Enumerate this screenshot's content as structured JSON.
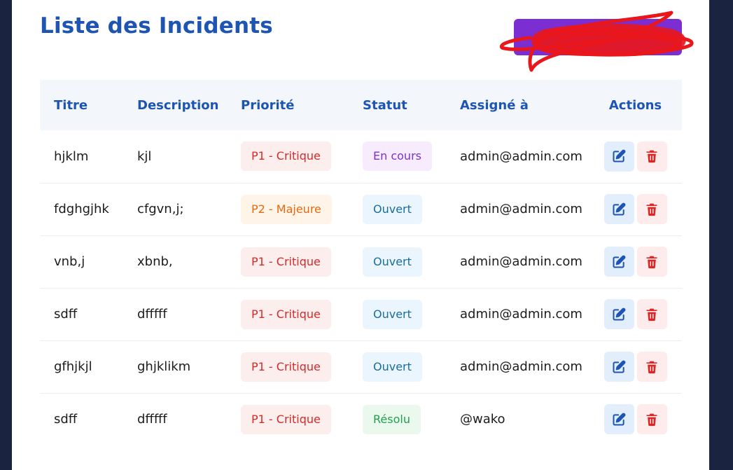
{
  "page": {
    "title": "Liste des Incidents",
    "add_button_label": ""
  },
  "colors": {
    "title": "#1e55b3",
    "add_button_bg": "#7b2fd2",
    "redaction": "#e8171c",
    "edit": "#1e55b3",
    "delete": "#dc2626"
  },
  "table": {
    "columns": [
      "Titre",
      "Description",
      "Priorité",
      "Statut",
      "Assigné à",
      "Actions"
    ],
    "rows": [
      {
        "titre": "hjklm",
        "description": "kjl",
        "priorite": "P1 - Critique",
        "priorite_level": "critical",
        "statut": "En cours",
        "statut_kind": "progress",
        "assigne": "admin@admin.com"
      },
      {
        "titre": "fdghgjhk",
        "description": "cfgvn,j;",
        "priorite": "P2 - Majeure",
        "priorite_level": "major",
        "statut": "Ouvert",
        "statut_kind": "open",
        "assigne": "admin@admin.com"
      },
      {
        "titre": "vnb,j",
        "description": "xbnb,",
        "priorite": "P1 - Critique",
        "priorite_level": "critical",
        "statut": "Ouvert",
        "statut_kind": "open",
        "assigne": "admin@admin.com"
      },
      {
        "titre": "sdff",
        "description": "dfffff",
        "priorite": "P1 - Critique",
        "priorite_level": "critical",
        "statut": "Ouvert",
        "statut_kind": "open",
        "assigne": "admin@admin.com"
      },
      {
        "titre": "gfhjkjl",
        "description": "ghjklikm",
        "priorite": "P1 - Critique",
        "priorite_level": "critical",
        "statut": "Ouvert",
        "statut_kind": "open",
        "assigne": "admin@admin.com"
      },
      {
        "titre": "sdff",
        "description": "dfffff",
        "priorite": "P1 - Critique",
        "priorite_level": "critical",
        "statut": "Résolu",
        "statut_kind": "resolved",
        "assigne": "@wako"
      }
    ],
    "action_icons": [
      "edit-icon",
      "trash-icon"
    ]
  },
  "badge_styles": {
    "critical": {
      "bg": "#fdeeee",
      "fg": "#d42a2a"
    },
    "major": {
      "bg": "#fff4e8",
      "fg": "#e36a12"
    },
    "progress": {
      "bg": "#f6ecfd",
      "fg": "#7e32c8"
    },
    "open": {
      "bg": "#ebf5fd",
      "fg": "#1a6d9c"
    },
    "resolved": {
      "bg": "#eaf8ee",
      "fg": "#23a04e"
    }
  }
}
